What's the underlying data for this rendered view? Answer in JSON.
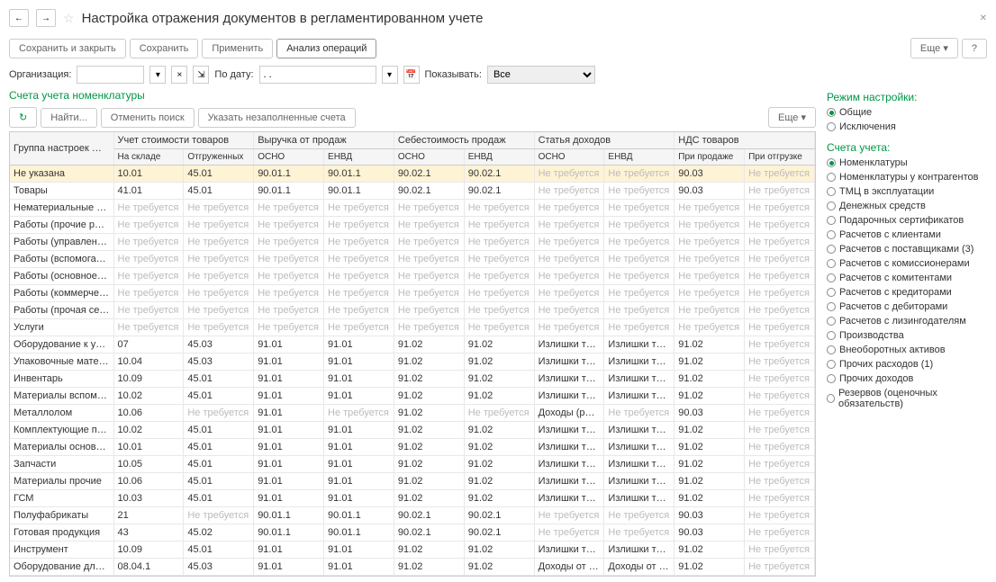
{
  "title": "Настройка отражения документов в регламентированном учете",
  "toolbar": {
    "save_close": "Сохранить и закрыть",
    "save": "Сохранить",
    "apply": "Применить",
    "analysis": "Анализ операций",
    "more": "Еще",
    "help": "?"
  },
  "filter": {
    "org_label": "Организация:",
    "date_label": "По дату:",
    "date_value": ". .",
    "show_label": "Показывать:",
    "show_value": "Все"
  },
  "section_title": "Счета учета номенклатуры",
  "tbl_toolbar": {
    "refresh": "↻",
    "find": "Найти...",
    "cancel_find": "Отменить поиск",
    "show_empty": "Указать незаполненные счета",
    "more": "Еще"
  },
  "headers": {
    "group": "Группа настроек фин. учета",
    "cost": "Учет стоимости товаров",
    "cost1": "На складе",
    "cost2": "Отгруженных",
    "rev": "Выручка от продаж",
    "rev1": "ОСНО",
    "rev2": "ЕНВД",
    "cogs": "Себестоимость продаж",
    "cogs1": "ОСНО",
    "cogs2": "ЕНВД",
    "inc": "Статья доходов",
    "inc1": "ОСНО",
    "inc2": "ЕНВД",
    "vat": "НДС товаров",
    "vat1": "При продаже",
    "vat2": "При отгрузке"
  },
  "na": "Не требуется",
  "izl": "Излишки товарно-мате...",
  "doh_r": "Доходы (расходы), св...",
  "doh_p": "Доходы от продажи (в...",
  "rows": [
    {
      "g": "Не указана",
      "c1": "10.01",
      "c2": "45.01",
      "r1": "90.01.1",
      "r2": "90.01.1",
      "s1": "90.02.1",
      "s2": "90.02.1",
      "i1": "",
      "i2": "",
      "v1": "90.03",
      "v2": "",
      "sel": true
    },
    {
      "g": "Товары",
      "c1": "41.01",
      "c2": "45.01",
      "r1": "90.01.1",
      "r2": "90.01.1",
      "s1": "90.02.1",
      "s2": "90.02.1",
      "i1": "",
      "i2": "",
      "v1": "90.03",
      "v2": ""
    },
    {
      "g": "Нематериальные активы в...",
      "c1": "",
      "c2": "",
      "r1": "",
      "r2": "",
      "s1": "",
      "s2": "",
      "i1": "",
      "i2": "",
      "v1": "",
      "v2": ""
    },
    {
      "g": "Работы (прочие расходы)",
      "c1": "",
      "c2": "",
      "r1": "",
      "r2": "",
      "s1": "",
      "s2": "",
      "i1": "",
      "i2": "",
      "v1": "",
      "v2": ""
    },
    {
      "g": "Работы (управленческие р...",
      "c1": "",
      "c2": "",
      "r1": "",
      "r2": "",
      "s1": "",
      "s2": "",
      "i1": "",
      "i2": "",
      "v1": "",
      "v2": ""
    },
    {
      "g": "Работы (вспомогательное ...",
      "c1": "",
      "c2": "",
      "r1": "",
      "r2": "",
      "s1": "",
      "s2": "",
      "i1": "",
      "i2": "",
      "v1": "",
      "v2": ""
    },
    {
      "g": "Работы (основное произво...",
      "c1": "",
      "c2": "",
      "r1": "",
      "r2": "",
      "s1": "",
      "s2": "",
      "i1": "",
      "i2": "",
      "v1": "",
      "v2": ""
    },
    {
      "g": "Работы (коммерческие ра...",
      "c1": "",
      "c2": "",
      "r1": "",
      "r2": "",
      "s1": "",
      "s2": "",
      "i1": "",
      "i2": "",
      "v1": "",
      "v2": ""
    },
    {
      "g": "Работы (прочая себестоим...",
      "c1": "",
      "c2": "",
      "r1": "",
      "r2": "",
      "s1": "",
      "s2": "",
      "i1": "",
      "i2": "",
      "v1": "",
      "v2": ""
    },
    {
      "g": "Услуги",
      "c1": "",
      "c2": "",
      "r1": "",
      "r2": "",
      "s1": "",
      "s2": "",
      "i1": "",
      "i2": "",
      "v1": "",
      "v2": ""
    },
    {
      "g": "Оборудование к установке",
      "c1": "07",
      "c2": "45.03",
      "r1": "91.01",
      "r2": "91.01",
      "s1": "91.02",
      "s2": "91.02",
      "i1": "izl",
      "i2": "izl",
      "v1": "91.02",
      "v2": ""
    },
    {
      "g": "Упаковочные материалы",
      "c1": "10.04",
      "c2": "45.03",
      "r1": "91.01",
      "r2": "91.01",
      "s1": "91.02",
      "s2": "91.02",
      "i1": "izl",
      "i2": "izl",
      "v1": "91.02",
      "v2": ""
    },
    {
      "g": "Инвентарь",
      "c1": "10.09",
      "c2": "45.01",
      "r1": "91.01",
      "r2": "91.01",
      "s1": "91.02",
      "s2": "91.02",
      "i1": "izl",
      "i2": "izl",
      "v1": "91.02",
      "v2": ""
    },
    {
      "g": "Материалы вспомогательн...",
      "c1": "10.02",
      "c2": "45.01",
      "r1": "91.01",
      "r2": "91.01",
      "s1": "91.02",
      "s2": "91.02",
      "i1": "izl",
      "i2": "izl",
      "v1": "91.02",
      "v2": ""
    },
    {
      "g": "Металлолом",
      "c1": "10.06",
      "c2": "",
      "r1": "91.01",
      "r2": "",
      "s1": "91.02",
      "s2": "",
      "i1": "doh_r",
      "i2": "",
      "v1": "90.03",
      "v2": ""
    },
    {
      "g": "Комплектующие покупные",
      "c1": "10.02",
      "c2": "45.01",
      "r1": "91.01",
      "r2": "91.01",
      "s1": "91.02",
      "s2": "91.02",
      "i1": "izl",
      "i2": "izl",
      "v1": "91.02",
      "v2": ""
    },
    {
      "g": "Материалы основные",
      "c1": "10.01",
      "c2": "45.01",
      "r1": "91.01",
      "r2": "91.01",
      "s1": "91.02",
      "s2": "91.02",
      "i1": "izl",
      "i2": "izl",
      "v1": "91.02",
      "v2": ""
    },
    {
      "g": "Запчасти",
      "c1": "10.05",
      "c2": "45.01",
      "r1": "91.01",
      "r2": "91.01",
      "s1": "91.02",
      "s2": "91.02",
      "i1": "izl",
      "i2": "izl",
      "v1": "91.02",
      "v2": ""
    },
    {
      "g": "Материалы прочие",
      "c1": "10.06",
      "c2": "45.01",
      "r1": "91.01",
      "r2": "91.01",
      "s1": "91.02",
      "s2": "91.02",
      "i1": "izl",
      "i2": "izl",
      "v1": "91.02",
      "v2": ""
    },
    {
      "g": "ГСМ",
      "c1": "10.03",
      "c2": "45.01",
      "r1": "91.01",
      "r2": "91.01",
      "s1": "91.02",
      "s2": "91.02",
      "i1": "izl",
      "i2": "izl",
      "v1": "91.02",
      "v2": ""
    },
    {
      "g": "Полуфабрикаты",
      "c1": "21",
      "c2": "",
      "r1": "90.01.1",
      "r2": "90.01.1",
      "s1": "90.02.1",
      "s2": "90.02.1",
      "i1": "",
      "i2": "",
      "v1": "90.03",
      "v2": ""
    },
    {
      "g": "Готовая продукция",
      "c1": "43",
      "c2": "45.02",
      "r1": "90.01.1",
      "r2": "90.01.1",
      "s1": "90.02.1",
      "s2": "90.02.1",
      "i1": "",
      "i2": "",
      "v1": "90.03",
      "v2": ""
    },
    {
      "g": "Инструмент",
      "c1": "10.09",
      "c2": "45.01",
      "r1": "91.01",
      "r2": "91.01",
      "s1": "91.02",
      "s2": "91.02",
      "i1": "izl",
      "i2": "izl",
      "v1": "91.02",
      "v2": ""
    },
    {
      "g": "Оборудование для собств...",
      "c1": "08.04.1",
      "c2": "45.03",
      "r1": "91.01",
      "r2": "91.01",
      "s1": "91.02",
      "s2": "91.02",
      "i1": "doh_p",
      "i2": "doh_p",
      "v1": "91.02",
      "v2": ""
    }
  ],
  "mode_title": "Режим настройки:",
  "modes": [
    {
      "l": "Общие",
      "c": true
    },
    {
      "l": "Исключения",
      "c": false
    }
  ],
  "accounts_title": "Счета учета:",
  "accounts": [
    {
      "l": "Номенклатуры",
      "c": true
    },
    {
      "l": "Номенклатуры у контрагентов"
    },
    {
      "l": "ТМЦ в эксплуатации"
    },
    {
      "l": "Денежных средств"
    },
    {
      "l": "Подарочных сертификатов"
    },
    {
      "l": "Расчетов с клиентами"
    },
    {
      "l": "Расчетов с поставщиками (3)"
    },
    {
      "l": "Расчетов с комиссионерами"
    },
    {
      "l": "Расчетов с комитентами"
    },
    {
      "l": "Расчетов с кредиторами"
    },
    {
      "l": "Расчетов с дебиторами"
    },
    {
      "l": "Расчетов с лизингодателям"
    },
    {
      "l": "Производства"
    },
    {
      "l": "Внеоборотных активов"
    },
    {
      "l": "Прочих расходов (1)"
    },
    {
      "l": "Прочих доходов"
    },
    {
      "l": "Резервов (оценочных обязательств)"
    }
  ]
}
